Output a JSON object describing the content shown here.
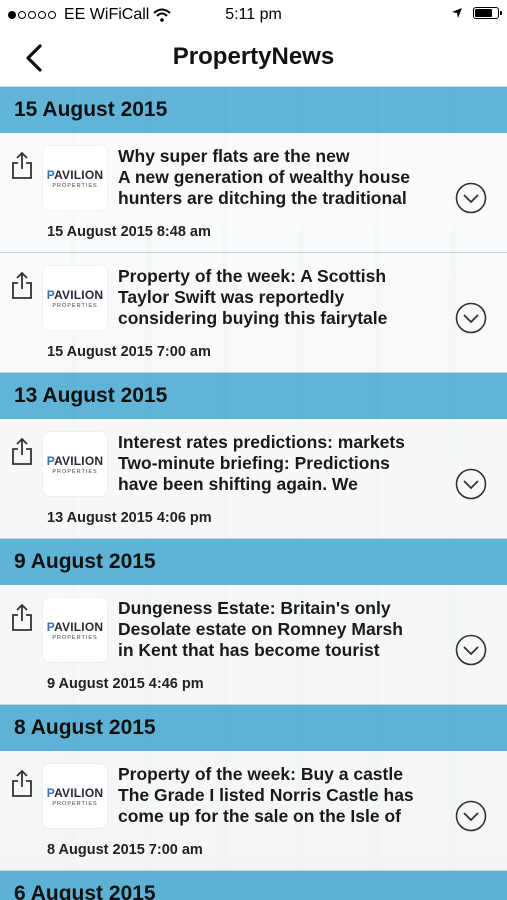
{
  "status": {
    "carrier": "EE WiFiCall",
    "time": "5:11 pm",
    "signal_dots_filled": 1,
    "signal_dots_total": 5
  },
  "nav": {
    "title": "PropertyNews"
  },
  "logo": {
    "brand_first": "P",
    "brand_rest": "AVILION",
    "sub": "PROPERTIES"
  },
  "groups": [
    {
      "date": "15 August 2015",
      "items": [
        {
          "title": "Why super flats are the new",
          "line2": "A new generation of wealthy house",
          "line3": "hunters are ditching the traditional",
          "time": "15 August 2015 8:48 am"
        },
        {
          "title": "Property of the week: A Scottish",
          "line2": "Taylor Swift was reportedly",
          "line3": "considering buying this fairytale",
          "time": "15 August 2015 7:00 am"
        }
      ]
    },
    {
      "date": "13 August 2015",
      "items": [
        {
          "title": "Interest rates predictions: markets",
          "line2": "Two-minute briefing: Predictions",
          "line3": "have been shifting again. We",
          "time": "13 August 2015 4:06 pm"
        }
      ]
    },
    {
      "date": "9 August 2015",
      "items": [
        {
          "title": "Dungeness Estate: Britain's only",
          "line2": "Desolate estate on Romney Marsh",
          "line3": "in Kent that has become tourist",
          "time": "9 August 2015 4:46 pm"
        }
      ]
    },
    {
      "date": "8 August 2015",
      "items": [
        {
          "title": "Property of the week: Buy a castle",
          "line2": "The Grade I listed Norris Castle has",
          "line3": "come up for the sale on the Isle of",
          "time": "8 August 2015 7:00 am"
        }
      ]
    },
    {
      "date": "6 August 2015",
      "items": []
    }
  ],
  "icons": {
    "back": "chevron-left-icon",
    "share": "share-icon",
    "expand": "chevron-down-circle-icon"
  },
  "colors": {
    "date_header": "#4aacd4"
  }
}
